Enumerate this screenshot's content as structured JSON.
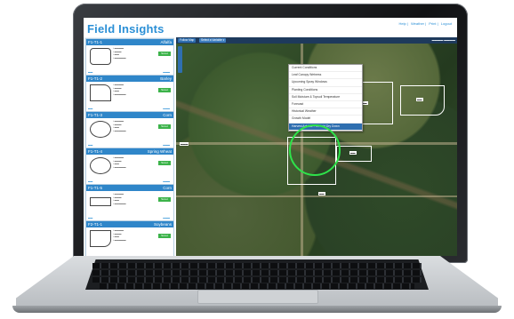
{
  "app": {
    "title": "Field Insights",
    "header_links": [
      "Help",
      "Weather",
      "Print",
      "Logout"
    ]
  },
  "map_toolbar": {
    "primary_button": "Follow Map",
    "select_label": "Select a Variable ▾"
  },
  "layer_menu": {
    "items": [
      {
        "label": "Current Conditions",
        "active": false
      },
      {
        "label": "Leaf Canopy Wetness",
        "active": false
      },
      {
        "label": "Upcoming Spray Windows",
        "active": false
      },
      {
        "label": "Planting Conditions",
        "active": false
      },
      {
        "label": "Soil Moisture & Topsoil Temperature",
        "active": false
      },
      {
        "label": "Forecast",
        "active": false
      },
      {
        "label": "Historical Weather",
        "active": false
      },
      {
        "label": "Growth Model",
        "active": false
      },
      {
        "label": "Harvest Advisor - In Field Dry Down",
        "active": true
      }
    ]
  },
  "fields": [
    {
      "id": "F1-T1-1",
      "crop": "Alfalfa",
      "button": "Scout"
    },
    {
      "id": "F1-T1-2",
      "crop": "Barley",
      "button": "Scout"
    },
    {
      "id": "F1-T1-3",
      "crop": "Corn",
      "button": "Scout"
    },
    {
      "id": "F1-T1-4",
      "crop": "Spring Wheat",
      "button": "Scout"
    },
    {
      "id": "F1-T1-5",
      "crop": "Corn",
      "button": "Scout"
    },
    {
      "id": "F2-T1-1",
      "crop": "Soybeans",
      "button": "Scout"
    }
  ],
  "colors": {
    "brand_blue": "#2a8fd6",
    "card_header": "#2f86c9",
    "scout_green": "#3cb34a",
    "pivot_green": "#2ee34a"
  }
}
